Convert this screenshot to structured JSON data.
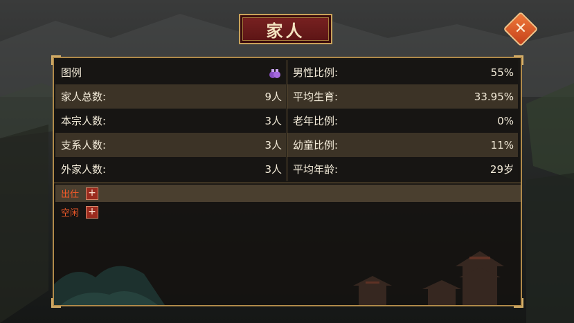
{
  "title": "家人",
  "close_icon": "close-icon",
  "legend": {
    "label": "图例",
    "icon": "purse-icon"
  },
  "left_stats": [
    {
      "label": "家人总数:",
      "value": "9人"
    },
    {
      "label": "本宗人数:",
      "value": "3人"
    },
    {
      "label": "支系人数:",
      "value": "3人"
    },
    {
      "label": "外家人数:",
      "value": "3人"
    }
  ],
  "right_stats": [
    {
      "label": "男性比例:",
      "value": "55%"
    },
    {
      "label": "平均生育:",
      "value": "33.95%"
    },
    {
      "label": "老年比例:",
      "value": "0%"
    },
    {
      "label": "幼童比例:",
      "value": "11%"
    },
    {
      "label": "平均年龄:",
      "value": "29岁"
    }
  ],
  "status_rows": [
    {
      "label": "出仕",
      "button": "+"
    },
    {
      "label": "空闲",
      "button": "+"
    }
  ],
  "colors": {
    "accent_red": "#f05a2a",
    "gold": "#b08a4a",
    "plate": "#7a2222"
  }
}
